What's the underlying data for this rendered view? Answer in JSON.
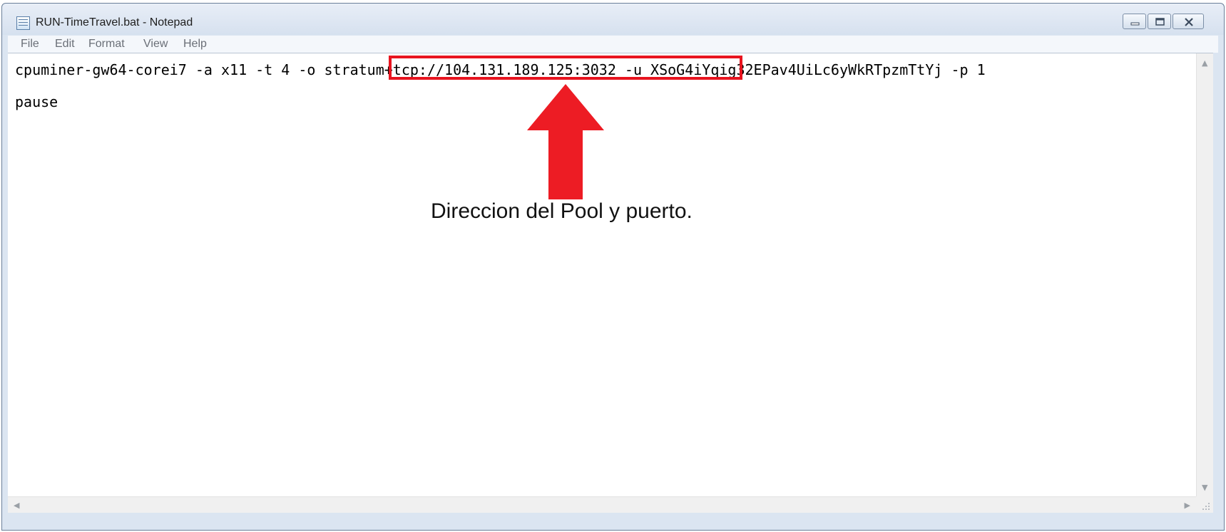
{
  "window": {
    "title": "RUN-TimeTravel.bat - Notepad",
    "icon": "notepad-icon",
    "controls": [
      "minimize-icon",
      "maximize-icon",
      "close-icon"
    ]
  },
  "menu": {
    "items": [
      "File",
      "Edit",
      "Format",
      "View",
      "Help"
    ]
  },
  "editor": {
    "lines": [
      "cpuminer-gw64-corei7 -a x11 -t 4 -o stratum+tcp://104.131.189.125:3032 -u XSoG4iYqig32EPav4UiLc6yWkRTpzmTtYj -p 1",
      "pause"
    ]
  },
  "annotation": {
    "text": "Direccion del Pool y puerto.",
    "highlight_color": "#e8141f",
    "arrow_color": "#ed1c24"
  }
}
